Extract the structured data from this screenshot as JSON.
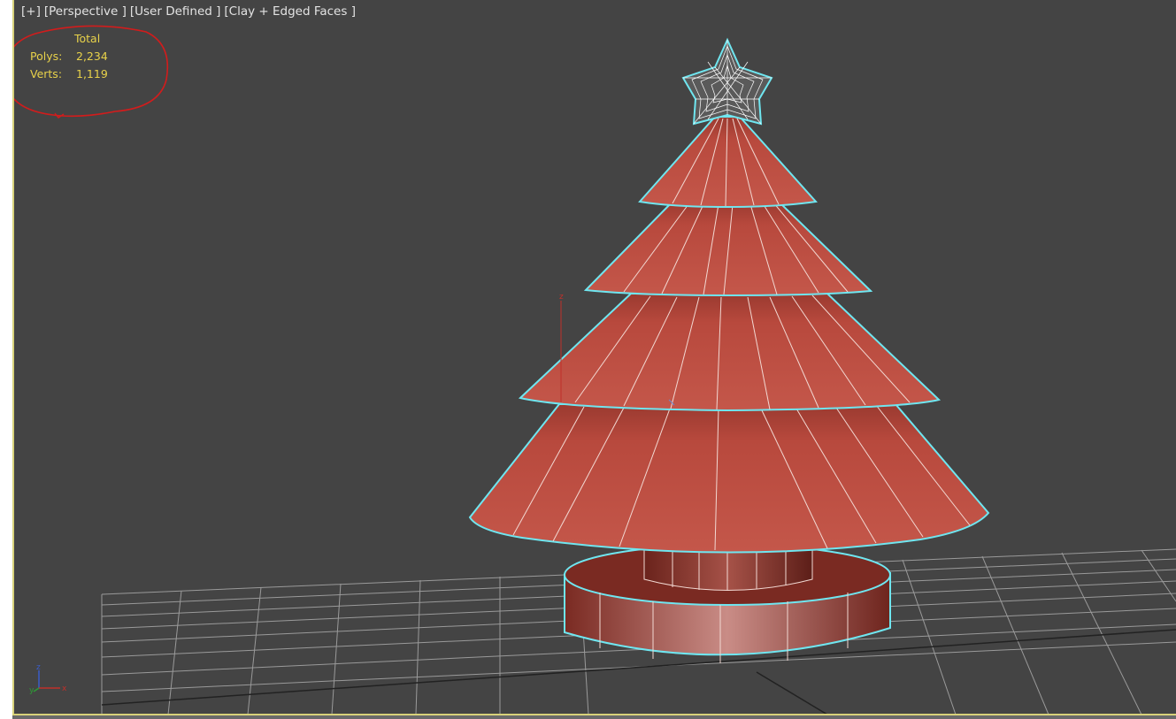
{
  "viewport": {
    "menu_label": "[+]",
    "view_label": "[Perspective ]",
    "camera_label": "[User Defined ]",
    "shading_label": "[Clay + Edged Faces ]"
  },
  "stats": {
    "header": "Total",
    "polys_label": "Polys:",
    "polys_value": "2,234",
    "verts_label": "Verts:",
    "verts_value": "1,119"
  },
  "gizmo": {
    "z": "z",
    "y": "y",
    "x": "x"
  },
  "colors": {
    "viewport_bg": "#444444",
    "stats_text": "#e8d24a",
    "annotation": "#d21c1c",
    "selection": "#6fe6f0",
    "clay": "#b54a3e"
  }
}
